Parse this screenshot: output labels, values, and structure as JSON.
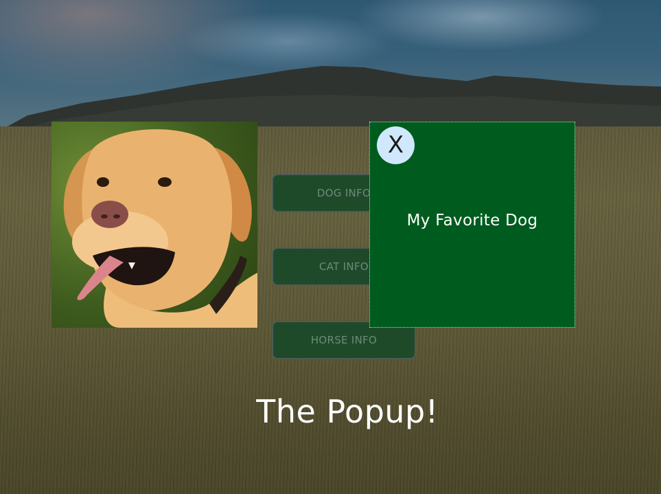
{
  "buttons": {
    "dog_label": "DOG INFO",
    "cat_label": "CAT INFO",
    "horse_label": "HORSE INFO"
  },
  "popup": {
    "close_label": "X",
    "message": "My Favorite Dog"
  },
  "heading": "The Popup!",
  "colors": {
    "popup_background": "#005c1e",
    "close_button": "#cfe8fb",
    "button_background": "#1e4a2a",
    "button_text": "#6f8a7a"
  },
  "icons": {
    "background": "wheat-field-landscape",
    "dog_photo": "golden-labrador"
  }
}
